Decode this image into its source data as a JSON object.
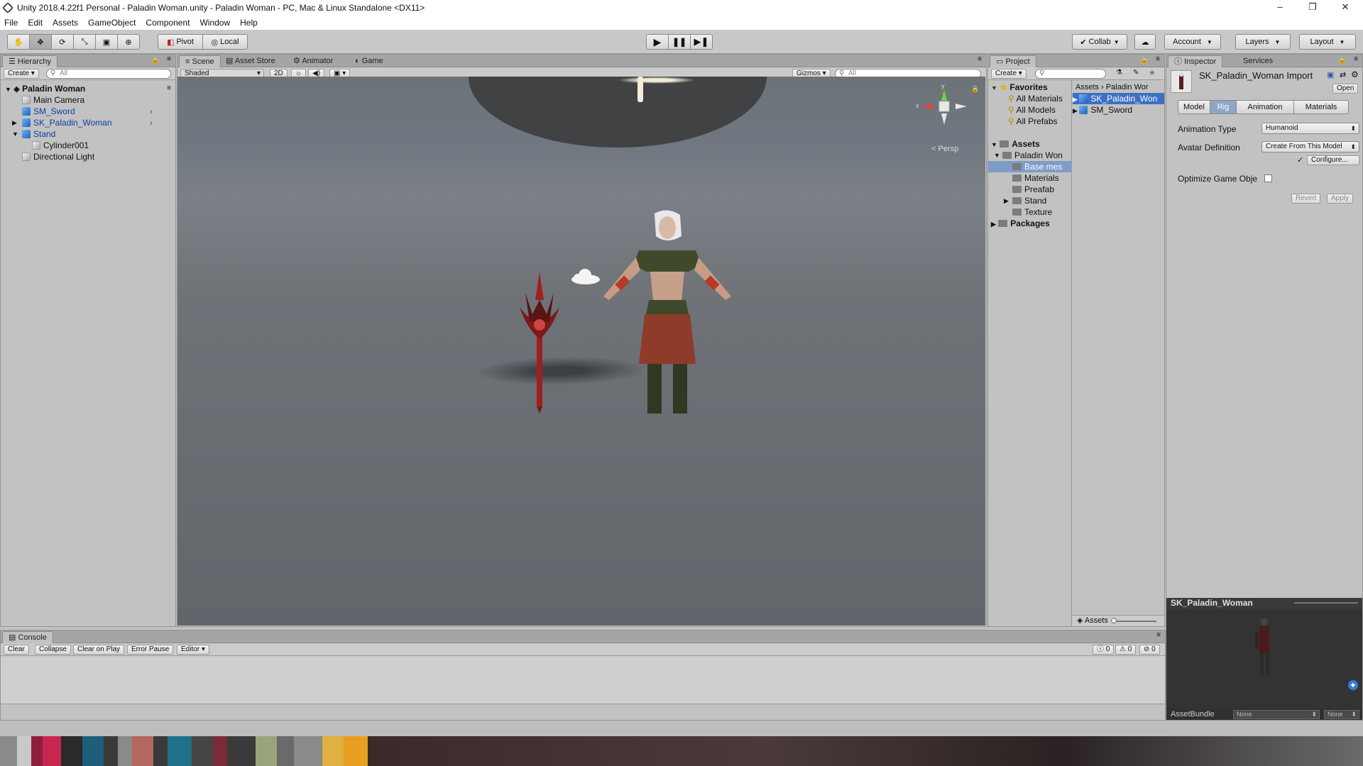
{
  "window": {
    "title": "Unity 2018.4.22f1 Personal - Paladin Woman.unity - Paladin Woman - PC, Mac & Linux Standalone <DX11>",
    "controls": [
      "–",
      "❐",
      "✕"
    ]
  },
  "menu": [
    "File",
    "Edit",
    "Assets",
    "GameObject",
    "Component",
    "Window",
    "Help"
  ],
  "toolbar": {
    "pivot": "Pivot",
    "local": "Local",
    "collab": "Collab",
    "account": "Account",
    "layers": "Layers",
    "layout": "Layout",
    "play_icons": [
      "play-icon",
      "pause-icon",
      "step-icon"
    ],
    "tool_icons": [
      "hand-icon",
      "move-icon",
      "rotate-icon",
      "scale-icon",
      "rect-icon",
      "transform-icon"
    ]
  },
  "hierarchy": {
    "tab": "Hierarchy",
    "create": "Create",
    "search_placeholder": "All",
    "scene": "Paladin Woman",
    "items": [
      {
        "label": "Main Camera",
        "kind": "grey",
        "depth": 1
      },
      {
        "label": "SM_Sword",
        "kind": "blue",
        "depth": 1
      },
      {
        "label": "SK_Paladin_Woman",
        "kind": "blue",
        "depth": 1
      },
      {
        "label": "Stand",
        "kind": "blue",
        "depth": 1
      },
      {
        "label": "Cylinder001",
        "kind": "grey",
        "depth": 2
      },
      {
        "label": "Directional Light",
        "kind": "grey",
        "depth": 1
      }
    ]
  },
  "scene_view": {
    "tabs": [
      "Scene",
      "Asset Store",
      "Animator",
      "Game"
    ],
    "shading": "Shaded",
    "mode_2d": "2D",
    "gizmos": "Gizmos",
    "search_placeholder": "All",
    "persp": "< Persp",
    "axis_x": "x",
    "axis_y": "y"
  },
  "project": {
    "tab": "Project",
    "create": "Create",
    "favorites": "Favorites",
    "favorite_items": [
      "All Materials",
      "All Models",
      "All Prefabs"
    ],
    "assets": "Assets",
    "asset_tree": [
      {
        "label": "Paladin Won",
        "depth": 1
      },
      {
        "label": "Base mes",
        "depth": 2,
        "selected": true
      },
      {
        "label": "Materials",
        "depth": 2
      },
      {
        "label": "Preafab",
        "depth": 2
      },
      {
        "label": "Stand",
        "depth": 2
      },
      {
        "label": "Texture",
        "depth": 2
      }
    ],
    "packages": "Packages",
    "breadcrumb": [
      "Assets",
      "Paladin Wor"
    ],
    "files": [
      "SK_Paladin_Won",
      "SM_Sword"
    ],
    "footer": "Assets"
  },
  "inspector": {
    "tabs": [
      "Inspector",
      "Services"
    ],
    "title": "SK_Paladin_Woman Import",
    "open": "Open",
    "subtabs": [
      "Model",
      "Rig",
      "Animation",
      "Materials"
    ],
    "active_subtab": "Rig",
    "animation_type_label": "Animation Type",
    "animation_type": "Humanoid",
    "avatar_label": "Avatar Definition",
    "avatar_value": "Create From This Model",
    "configure": "Configure...",
    "optimize_label": "Optimize Game Obje",
    "revert": "Revert",
    "apply": "Apply",
    "preview_title": "SK_Paladin_Woman",
    "assetbundle_label": "AssetBundle",
    "assetbundle_value": "None",
    "assetbundle_variant": "None"
  },
  "console": {
    "tab": "Console",
    "buttons": [
      "Clear",
      "Collapse",
      "Clear on Play",
      "Error Pause",
      "Editor"
    ],
    "counts": [
      "0",
      "0",
      "0"
    ]
  },
  "colors": {
    "selection": "#3d6fc4",
    "blue_text": "#0b3fa8",
    "scene_bg": "#6c7176"
  }
}
